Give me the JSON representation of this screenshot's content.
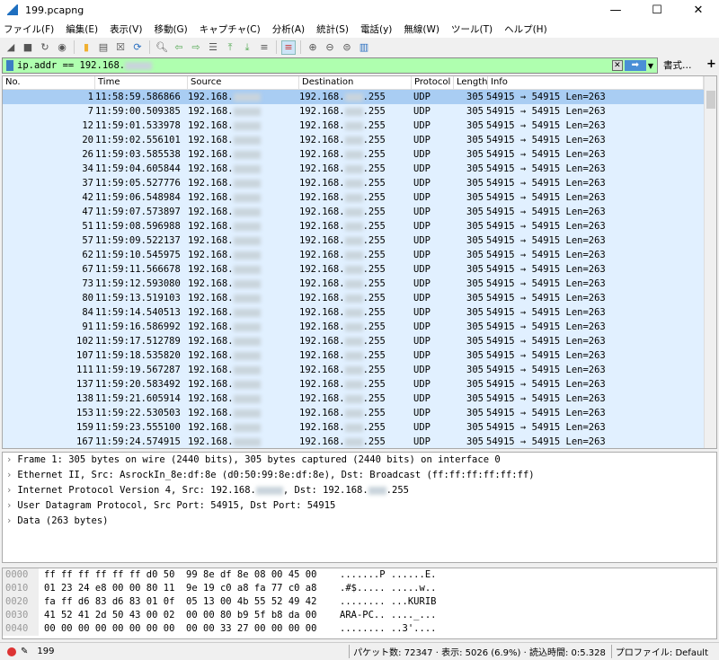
{
  "window": {
    "title": "199.pcapng",
    "min": "—",
    "max": "☐",
    "close": "✕"
  },
  "menu": [
    "ファイル(F)",
    "編集(E)",
    "表示(V)",
    "移動(G)",
    "キャプチャ(C)",
    "分析(A)",
    "統計(S)",
    "電話(y)",
    "無線(W)",
    "ツール(T)",
    "ヘルプ(H)"
  ],
  "filter": {
    "value": "ip.addr == 192.168.",
    "format_label": "書式…",
    "add_label": "+"
  },
  "columns": [
    "No.",
    "Time",
    "Source",
    "Destination",
    "Protocol",
    "Length",
    "Info"
  ],
  "rows": [
    [
      "1",
      "11:58:59.586866"
    ],
    [
      "7",
      "11:59:00.509385"
    ],
    [
      "12",
      "11:59:01.533978"
    ],
    [
      "20",
      "11:59:02.556101"
    ],
    [
      "26",
      "11:59:03.585538"
    ],
    [
      "34",
      "11:59:04.605844"
    ],
    [
      "37",
      "11:59:05.527776"
    ],
    [
      "42",
      "11:59:06.548984"
    ],
    [
      "47",
      "11:59:07.573897"
    ],
    [
      "51",
      "11:59:08.596988"
    ],
    [
      "57",
      "11:59:09.522137"
    ],
    [
      "62",
      "11:59:10.545975"
    ],
    [
      "67",
      "11:59:11.566678"
    ],
    [
      "73",
      "11:59:12.593080"
    ],
    [
      "80",
      "11:59:13.519103"
    ],
    [
      "84",
      "11:59:14.540513"
    ],
    [
      "91",
      "11:59:16.586992"
    ],
    [
      "102",
      "11:59:17.512789"
    ],
    [
      "107",
      "11:59:18.535820"
    ],
    [
      "111",
      "11:59:19.567287"
    ],
    [
      "137",
      "11:59:20.583492"
    ],
    [
      "138",
      "11:59:21.605914"
    ],
    [
      "153",
      "11:59:22.530503"
    ],
    [
      "159",
      "11:59:23.555100"
    ],
    [
      "167",
      "11:59:24.574915"
    ]
  ],
  "row_common": {
    "src_prefix": "192.168.",
    "dst_prefix": "192.168.",
    "dst_suffix": ".255",
    "protocol": "UDP",
    "length": "305",
    "info": "54915 → 54915 Len=263"
  },
  "details": [
    "Frame 1: 305 bytes on wire (2440 bits), 305 bytes captured (2440 bits) on interface 0",
    "Ethernet II, Src: AsrockIn_8e:df:8e (d0:50:99:8e:df:8e), Dst: Broadcast (ff:ff:ff:ff:ff:ff)",
    "Internet Protocol Version 4, Src: 192.168.",
    "User Datagram Protocol, Src Port: 54915, Dst Port: 54915",
    "Data (263 bytes)"
  ],
  "ip_detail": {
    "dst": ", Dst: 192.168.",
    "dst_suffix": ".255"
  },
  "hex": [
    [
      "0000",
      "ff ff ff ff ff ff d0 50  99 8e df 8e 08 00 45 00",
      ".......P ......E."
    ],
    [
      "0010",
      "01 23 24 e8 00 00 80 11  9e 19 c0 a8 fa 77 c0 a8",
      ".#$..... .....w.."
    ],
    [
      "0020",
      "fa ff d6 83 d6 83 01 0f  05 13 00 4b 55 52 49 42",
      "........ ...KURIB"
    ],
    [
      "0030",
      "41 52 41 2d 50 43 00 02  00 00 80 b9 5f b8 da 00",
      "ARA-PC.. ...._..."
    ],
    [
      "0040",
      "00 00 00 00 00 00 00 00  00 00 33 27 00 00 00 00",
      "........ ..3'...."
    ]
  ],
  "status": {
    "file": "199",
    "packets": "パケット数: 72347 · 表示: 5026 (6.9%) · 読込時間: 0:5.328",
    "profile": "プロファイル: Default"
  },
  "colors": {
    "filter_ok": "#afffaf",
    "row_bg": "#e1f0ff",
    "selected": "#a9cdf3"
  }
}
